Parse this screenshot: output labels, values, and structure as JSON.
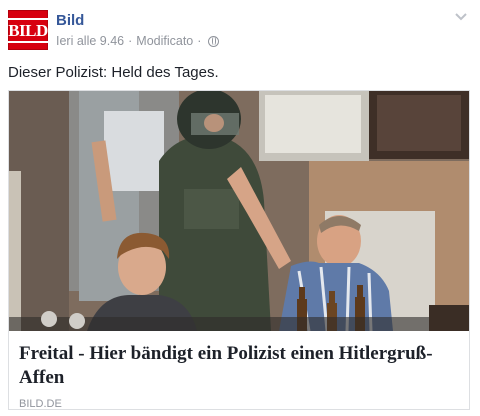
{
  "page": {
    "name": "Bild",
    "timestamp": "Ieri alle 9.46",
    "edited": "Modificato",
    "separator": "·",
    "logo_text": "BILD"
  },
  "post": {
    "text": "Dieser Polizist: Held des Tages."
  },
  "link_card": {
    "title": "Freital - Hier bändigt ein Polizist einen Hitlergruß-Affen",
    "domain": "BILD.DE"
  },
  "colors": {
    "brand": "#d7000f",
    "page_name": "#365899",
    "meta": "#90949c"
  },
  "icons": {
    "privacy": "globe-icon",
    "options": "chevron-down-icon"
  }
}
